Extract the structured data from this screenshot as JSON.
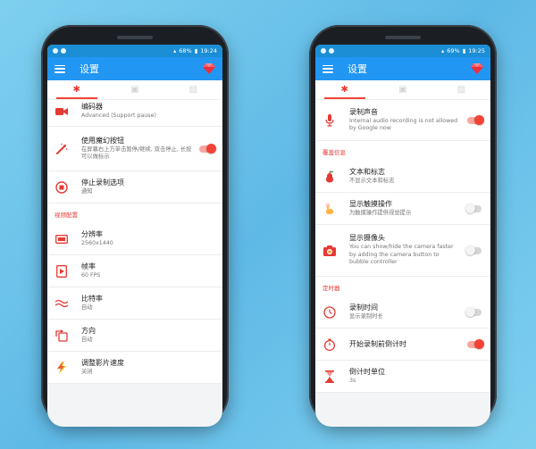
{
  "colors": {
    "accent": "#f44336",
    "appbar": "#2196f3",
    "statusbar": "#1b8ed6"
  },
  "left": {
    "status": {
      "battery": "68%",
      "time": "19:24"
    },
    "title": "设置",
    "items_a": [
      {
        "name": "encoder",
        "icon": "video-camera-icon",
        "title": "编码器",
        "sub": "Advanced (Support pause)"
      },
      {
        "name": "magic-button",
        "icon": "magic-wand-icon",
        "title": "使用魔幻按钮",
        "sub": "在屏幕右上方单击暂停/继续, 双击停止, 长按可以做标示",
        "switch": true
      },
      {
        "name": "stop-options",
        "icon": "stop-circle-icon",
        "title": "停止录制选项",
        "sub": "通知"
      }
    ],
    "section": "视频配置",
    "items_b": [
      {
        "name": "resolution",
        "icon": "resolution-icon",
        "title": "分辨率",
        "sub": "2560x1440"
      },
      {
        "name": "frame-rate",
        "icon": "frame-rate-icon",
        "title": "帧率",
        "sub": "60 FPS"
      },
      {
        "name": "bitrate",
        "icon": "bitrate-wave-icon",
        "title": "比特率",
        "sub": "自动"
      },
      {
        "name": "orientation",
        "icon": "rotate-icon",
        "title": "方向",
        "sub": "自动"
      },
      {
        "name": "speed",
        "icon": "lightning-icon",
        "title": "调整影片速度",
        "sub": "关闭"
      }
    ]
  },
  "right": {
    "status": {
      "battery": "69%",
      "time": "19:25"
    },
    "title": "设置",
    "items_a": [
      {
        "name": "record-audio",
        "icon": "microphone-icon",
        "title": "录制声音",
        "sub": "Internal audio recording is not allowed by Google now",
        "switch": true
      }
    ],
    "section1": "覆盖信息",
    "items_b": [
      {
        "name": "text-logo",
        "icon": "pear-icon",
        "title": "文本和标志",
        "sub": "不显示文本和标志"
      },
      {
        "name": "show-touches",
        "icon": "touch-hand-icon",
        "title": "显示触摸操作",
        "sub": "为触摸操作提供视觉提示",
        "switch": false
      },
      {
        "name": "show-camera",
        "icon": "camera-icon",
        "title": "显示摄像头",
        "sub": "You can show/hide the camera faster by adding the camera button to bubble controller",
        "switch": false
      }
    ],
    "section2": "定时器",
    "items_c": [
      {
        "name": "record-duration",
        "icon": "clock-icon",
        "title": "录制时间",
        "sub": "显示录制时长",
        "switch": false
      },
      {
        "name": "countdown",
        "icon": "stopwatch-icon",
        "title": "开始录制前倒计时",
        "sub": "",
        "switch": true
      },
      {
        "name": "countdown-unit",
        "icon": "hourglass-icon",
        "title": "倒计时单位",
        "sub": "3s"
      }
    ]
  }
}
